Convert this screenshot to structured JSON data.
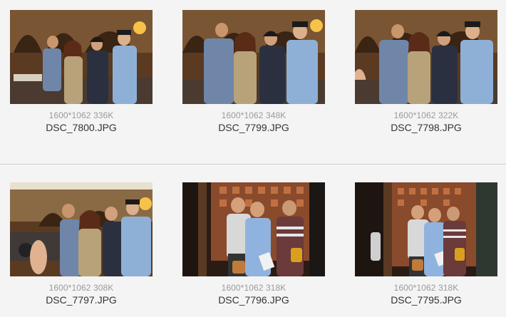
{
  "files": [
    {
      "meta": "1600*1062 336K",
      "name": "DSC_7800.JPG"
    },
    {
      "meta": "1600*1062 348K",
      "name": "DSC_7799.JPG"
    },
    {
      "meta": "1600*1062 322K",
      "name": "DSC_7798.JPG"
    },
    {
      "meta": "1600*1062 308K",
      "name": "DSC_7797.JPG"
    },
    {
      "meta": "1600*1062 318K",
      "name": "DSC_7796.JPG"
    },
    {
      "meta": "1600*1062 318K",
      "name": "DSC_7795.JPG"
    }
  ]
}
